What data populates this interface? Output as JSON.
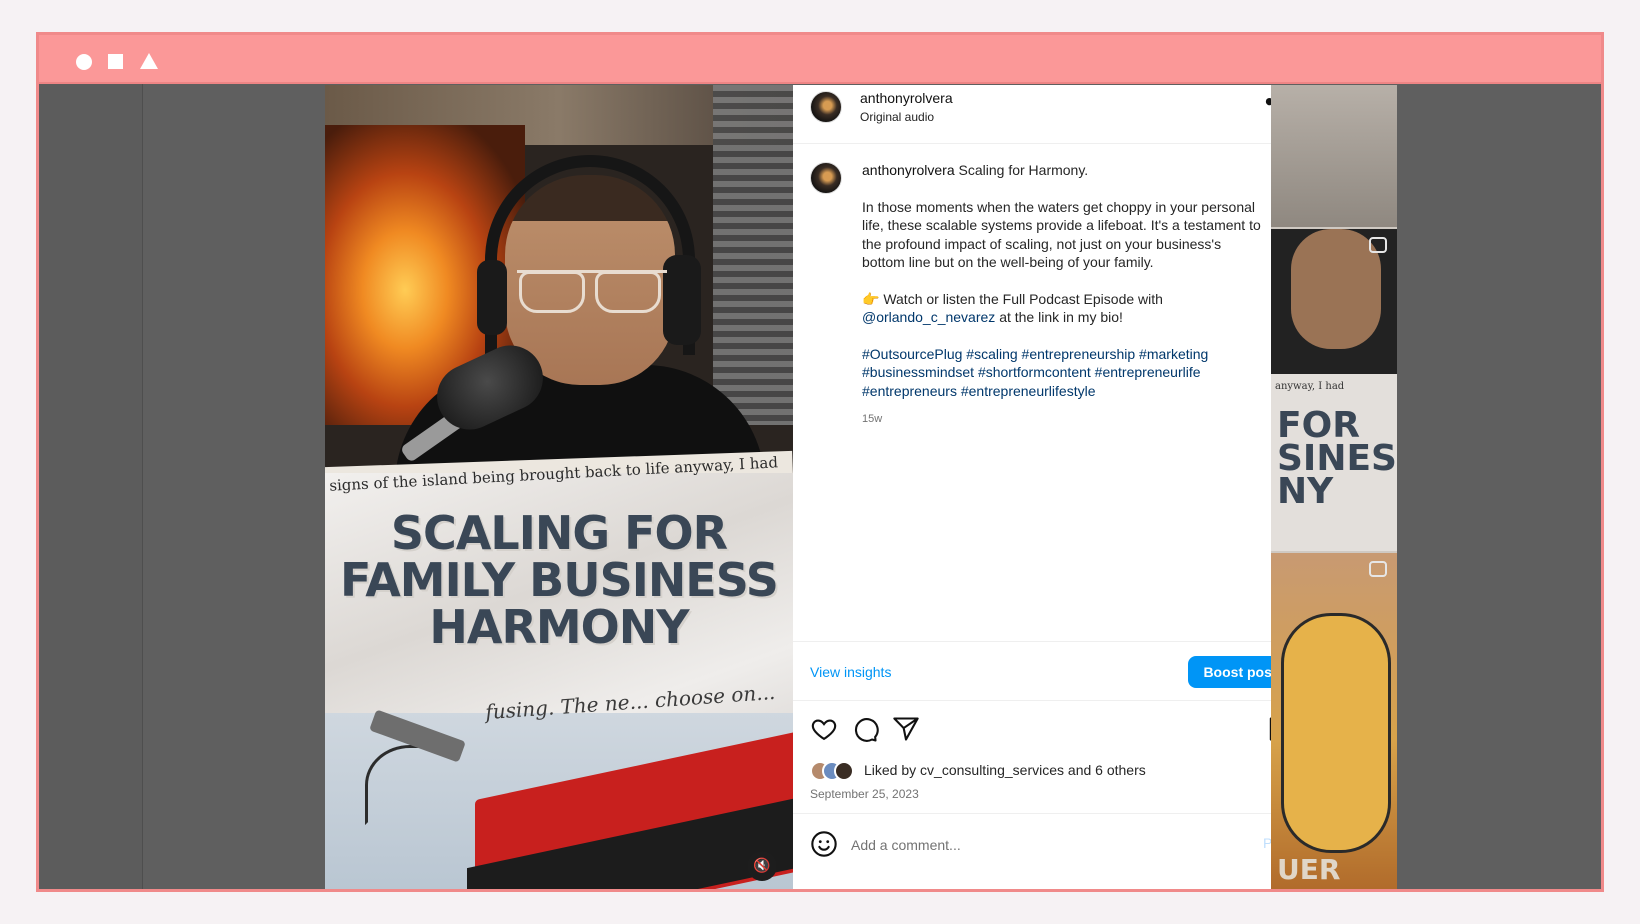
{
  "window": {
    "controls": [
      "circle",
      "square",
      "triangle"
    ]
  },
  "video": {
    "scrap_text": "signs of the island being brought back to life anyway, I had",
    "headline": [
      "SCALING FOR",
      "FAMILY BUSINESS",
      "HARMONY"
    ],
    "scrap_bottom": "fusing. The ne... choose on...",
    "mute_icon": "speaker-muted-icon"
  },
  "thumbnails": {
    "t2_scrap": "anyway, I had",
    "t2_text": [
      "FOR",
      "SINESS",
      "NY"
    ],
    "t3_text": "UER"
  },
  "post": {
    "header": {
      "username": "anthonyrolvera",
      "audio": "Original audio",
      "more": "..."
    },
    "caption": {
      "username": "anthonyrolvera",
      "title": "Scaling for Harmony.",
      "paragraph": "In those moments when the waters get choppy in your personal life, these scalable systems provide a lifeboat. It's a testament to the profound impact of scaling, not just on your business's bottom line but on the well-being of your family.",
      "cta_emoji": "👉",
      "cta_text": "Watch or listen the Full Podcast Episode with",
      "mention": "@orlando_c_nevarez",
      "cta_tail": "at the link in my bio!",
      "hashtags": "#OutsourcePlug #scaling #entrepreneurship #marketing #businessmindset #shortformcontent #entrepreneurlife #entrepreneurs #entrepreneurlifestyle",
      "age": "15w"
    },
    "insights": {
      "view_label": "View insights",
      "boost_label": "Boost post"
    },
    "likes": {
      "prefix": "Liked by",
      "user": "cv_consulting_services",
      "and": "and",
      "others": "6 others"
    },
    "date": "September 25, 2023",
    "comment": {
      "placeholder": "Add a comment...",
      "post_label": "Post"
    }
  },
  "colors": {
    "accent": "#0095f6",
    "frame": "#fb9898",
    "link": "#00376b"
  }
}
